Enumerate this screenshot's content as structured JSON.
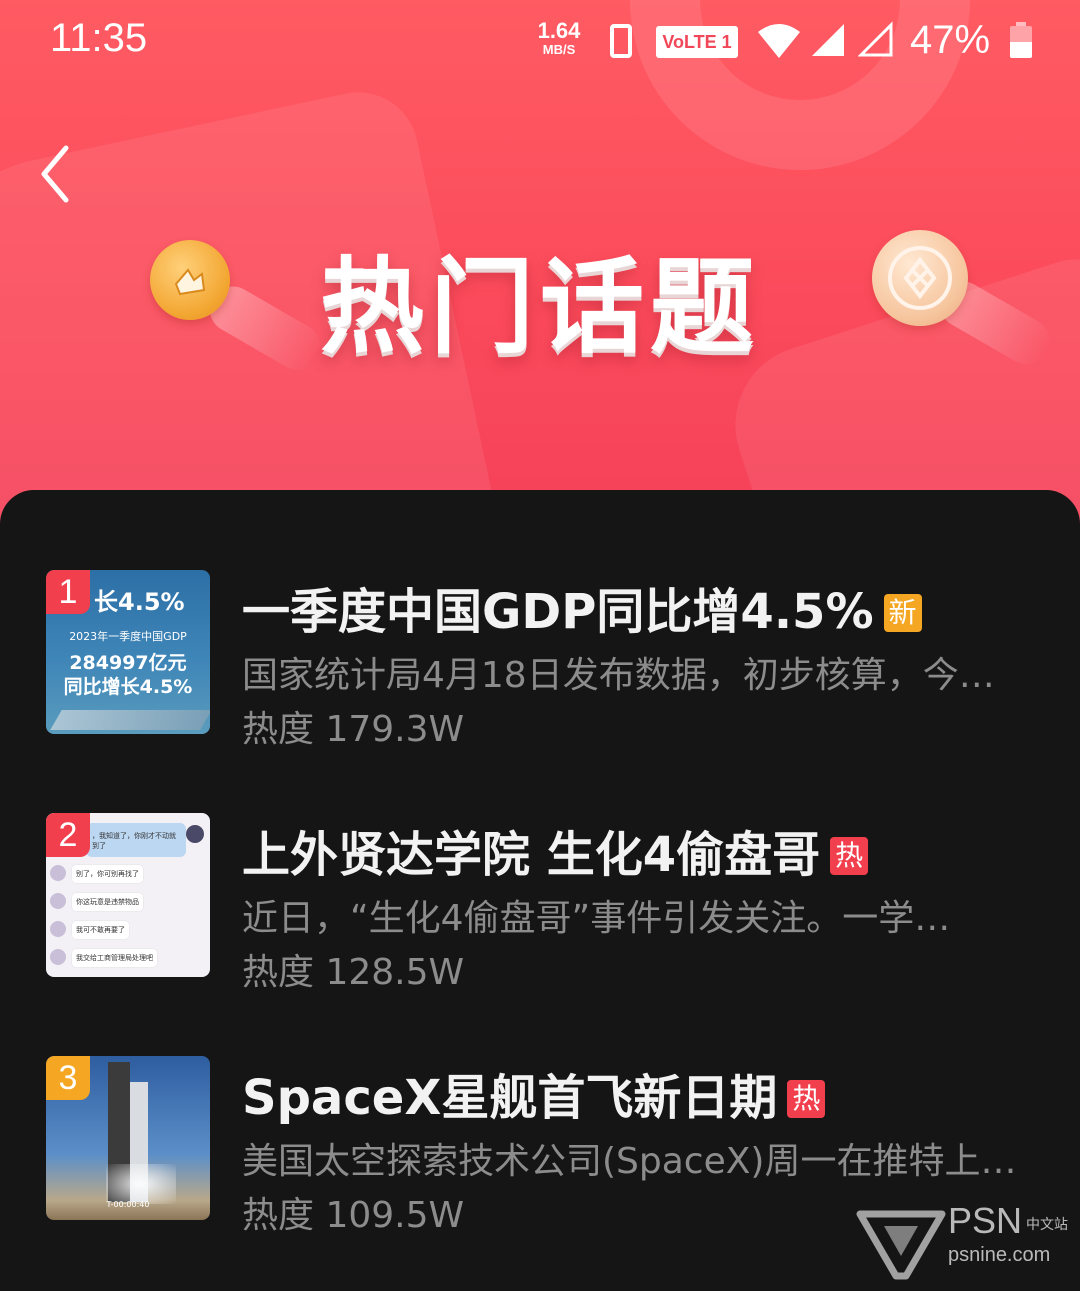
{
  "status_bar": {
    "time": "11:35",
    "net_speed_value": "1.64",
    "net_speed_unit": "MB/S",
    "volte_label": "VoLTE 1",
    "battery_percent": "47%"
  },
  "header": {
    "title": "热门话题",
    "accent_color": "#fb4a5b"
  },
  "topics": [
    {
      "rank": "1",
      "rank_color": "#f23f4d",
      "title": "一季度中国GDP同比增4.5%",
      "tag": "新",
      "tag_type": "new",
      "description": "国家统计局4月18日发布数据，初步核算，今…",
      "heat": "热度 179.3W",
      "thumb": {
        "headline": "长4.5%",
        "subline": "2023年一季度中国GDP",
        "line1": "284997亿元",
        "line2": "同比增长4.5%"
      }
    },
    {
      "rank": "2",
      "rank_color": "#f23f4d",
      "title": "上外贤达学院 生化4偷盘哥",
      "tag": "热",
      "tag_type": "hot",
      "description": "近日，“生化4偷盘哥”事件引发关注。一学…",
      "heat": "热度 128.5W",
      "thumb": {
        "top_text": "，我知道了，你刚才不动就到了",
        "messages": [
          "别了，你可别再找了",
          "你这玩意是违禁物品",
          "我可不敢再要了",
          "我交给工商管理局处理吧"
        ]
      }
    },
    {
      "rank": "3",
      "rank_color": "#f5a623",
      "title": "SpaceX星舰首飞新日期",
      "tag": "热",
      "tag_type": "hot",
      "description": "美国太空探索技术公司(SpaceX)周一在推特上…",
      "heat": "热度 109.5W",
      "thumb": {
        "timer": "T-00:00:40"
      }
    }
  ],
  "watermark": {
    "brand": "PSN",
    "brand_cn": "中文站",
    "domain": "psnine.com"
  }
}
